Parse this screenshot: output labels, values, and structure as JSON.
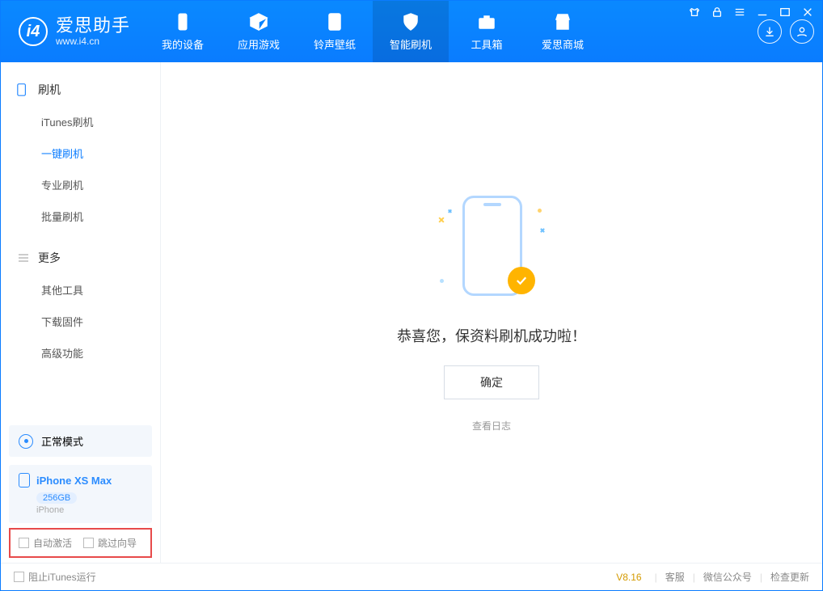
{
  "brand": {
    "title": "爱思助手",
    "subtitle": "www.i4.cn"
  },
  "tabs": [
    {
      "label": "我的设备"
    },
    {
      "label": "应用游戏"
    },
    {
      "label": "铃声壁纸"
    },
    {
      "label": "智能刷机"
    },
    {
      "label": "工具箱"
    },
    {
      "label": "爱思商城"
    }
  ],
  "sidebar": {
    "group1": {
      "title": "刷机",
      "items": [
        {
          "label": "iTunes刷机"
        },
        {
          "label": "一键刷机"
        },
        {
          "label": "专业刷机"
        },
        {
          "label": "批量刷机"
        }
      ]
    },
    "group2": {
      "title": "更多",
      "items": [
        {
          "label": "其他工具"
        },
        {
          "label": "下载固件"
        },
        {
          "label": "高级功能"
        }
      ]
    },
    "mode_label": "正常模式",
    "device": {
      "name": "iPhone XS Max",
      "storage": "256GB",
      "type": "iPhone"
    },
    "checks": {
      "auto_activate": "自动激活",
      "skip_guide": "跳过向导"
    }
  },
  "main": {
    "success_msg": "恭喜您，保资料刷机成功啦！",
    "ok_label": "确定",
    "log_link": "查看日志"
  },
  "footer": {
    "block_itunes": "阻止iTunes运行",
    "version": "V8.16",
    "links": [
      "客服",
      "微信公众号",
      "检查更新"
    ]
  }
}
